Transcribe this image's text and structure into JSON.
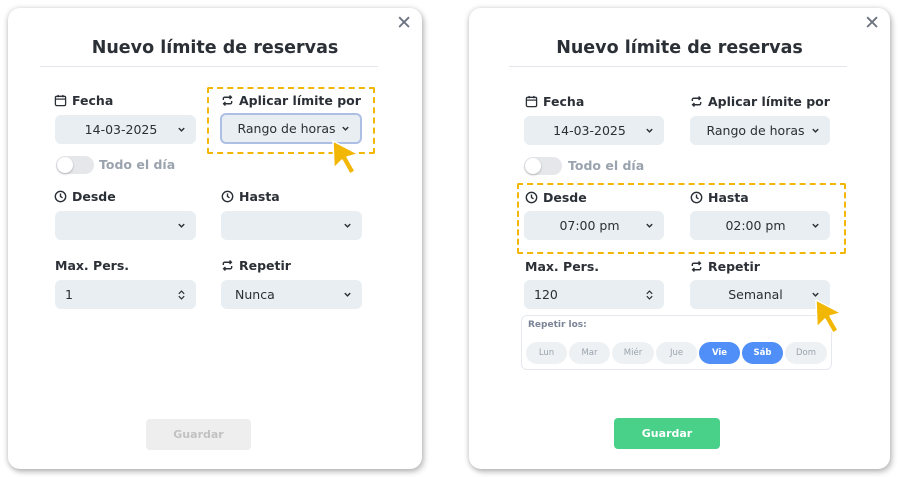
{
  "modal_a": {
    "title": "Nuevo límite de reservas",
    "close_symbol": "✕",
    "fecha_label": "Fecha",
    "fecha_value": "14-03-2025",
    "aplicar_label": "Aplicar límite por",
    "aplicar_value": "Rango de horas",
    "todo_el_dia_label": "Todo el día",
    "desde_label": "Desde",
    "desde_value": "",
    "hasta_label": "Hasta",
    "hasta_value": "",
    "max_pers_label": "Max. Pers.",
    "max_pers_value": "1",
    "repetir_label": "Repetir",
    "repetir_value": "Nunca",
    "save_label": "Guardar"
  },
  "modal_b": {
    "title": "Nuevo límite de reservas",
    "close_symbol": "✕",
    "fecha_label": "Fecha",
    "fecha_value": "14-03-2025",
    "aplicar_label": "Aplicar límite por",
    "aplicar_value": "Rango de horas",
    "todo_el_dia_label": "Todo el día",
    "desde_label": "Desde",
    "desde_value": "07:00 pm",
    "hasta_label": "Hasta",
    "hasta_value": "02:00 pm",
    "max_pers_label": "Max. Pers.",
    "max_pers_value": "120",
    "repetir_label": "Repetir",
    "repetir_value": "Semanal",
    "repetir_los_label": "Repetir los:",
    "days": [
      {
        "label": "Lun",
        "selected": false
      },
      {
        "label": "Mar",
        "selected": false
      },
      {
        "label": "Miér",
        "selected": false
      },
      {
        "label": "Jue",
        "selected": false
      },
      {
        "label": "Vie",
        "selected": true
      },
      {
        "label": "Sáb",
        "selected": true
      },
      {
        "label": "Dom",
        "selected": false
      }
    ],
    "save_label": "Guardar"
  },
  "colors": {
    "highlight": "#f2b705",
    "primary_button": "#49d18a",
    "selected_day": "#4f8ff7",
    "field_background": "#e8eef1"
  },
  "icons": {
    "fecha": "calendar-icon",
    "aplicar": "repeat-icon",
    "desde": "clock-icon",
    "hasta": "clock-icon",
    "repetir": "repeat-icon",
    "pointer": "hand-pointer-icon"
  }
}
